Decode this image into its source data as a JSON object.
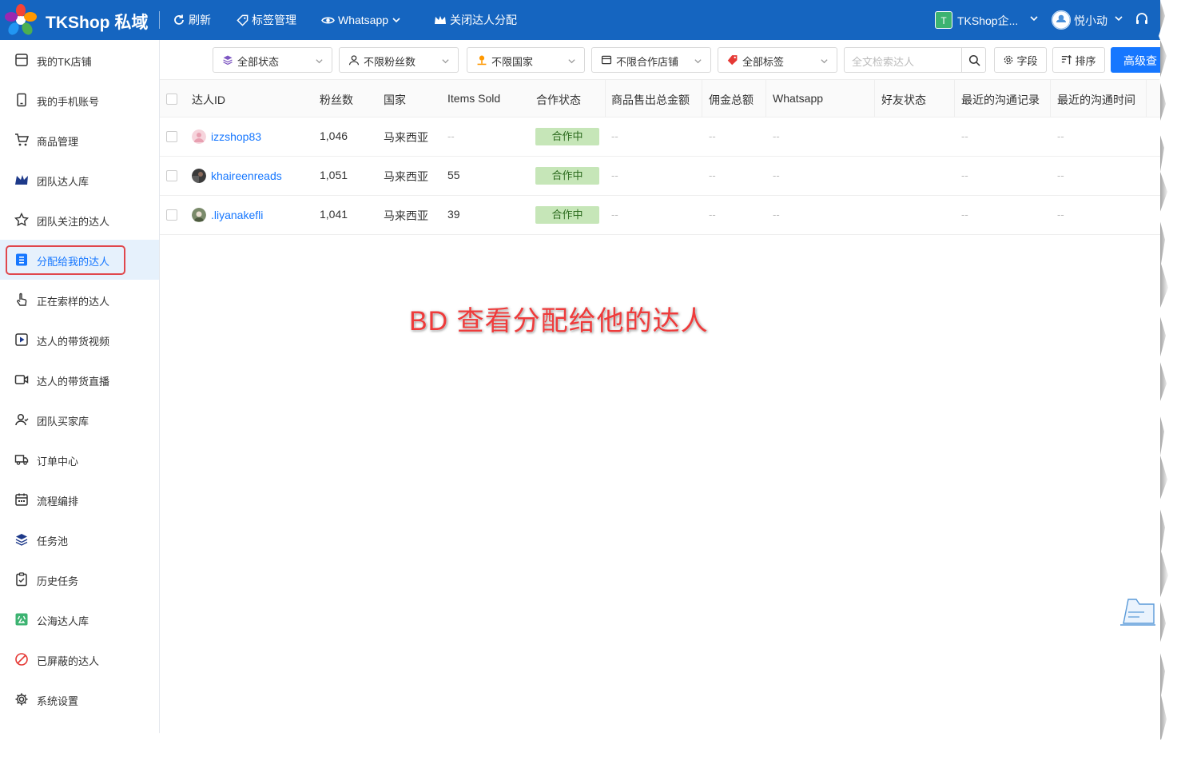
{
  "header": {
    "brand": "TKShop 私域",
    "refresh_label": "刷新",
    "tag_manage_label": "标签管理",
    "whatsapp_label": "Whatsapp",
    "close_assign_label": "关闭达人分配",
    "workspace_badge": "T",
    "workspace_name": "TKShop企...",
    "user_name": "悦小动"
  },
  "sidebar": {
    "items": [
      {
        "label": "我的TK店铺",
        "icon": "shop-icon"
      },
      {
        "label": "我的手机账号",
        "icon": "phone-icon"
      },
      {
        "label": "商品管理",
        "icon": "cart-icon"
      },
      {
        "label": "团队达人库",
        "icon": "team-creators-icon"
      },
      {
        "label": "团队关注的达人",
        "icon": "star-icon"
      },
      {
        "label": "分配给我的达人",
        "icon": "assigned-icon"
      },
      {
        "label": "正在索样的达人",
        "icon": "hand-icon"
      },
      {
        "label": "达人的带货视频",
        "icon": "video-icon"
      },
      {
        "label": "达人的带货直播",
        "icon": "live-icon"
      },
      {
        "label": "团队买家库",
        "icon": "buyers-icon"
      },
      {
        "label": "订单中心",
        "icon": "truck-icon"
      },
      {
        "label": "流程编排",
        "icon": "calendar-icon"
      },
      {
        "label": "任务池",
        "icon": "layers-icon"
      },
      {
        "label": "历史任务",
        "icon": "clipboard-icon"
      },
      {
        "label": "公海达人库",
        "icon": "public-pool-icon"
      },
      {
        "label": "已屏蔽的达人",
        "icon": "block-icon"
      },
      {
        "label": "系统设置",
        "icon": "gear-icon"
      }
    ],
    "active_index": 5
  },
  "filters": {
    "status": "全部状态",
    "fans": "不限粉丝数",
    "country": "不限国家",
    "shop": "不限合作店铺",
    "tags": "全部标签",
    "search_placeholder": "全文检索达人",
    "fields_label": "字段",
    "sort_label": "排序",
    "advanced_label": "高级查"
  },
  "table": {
    "columns": [
      "达人ID",
      "粉丝数",
      "国家",
      "Items Sold",
      "合作状态",
      "商品售出总金额",
      "佣金总额",
      "Whatsapp",
      "好友状态",
      "最近的沟通记录",
      "最近的沟通时间"
    ],
    "rows": [
      {
        "id": "izzshop83",
        "fans": "1,046",
        "country": "马来西亚",
        "items_sold": "--",
        "status": "合作中",
        "sales": "--",
        "commission": "--",
        "whatsapp": "--",
        "friend": "",
        "last_record": "--",
        "last_time": "--"
      },
      {
        "id": "khaireenreads",
        "fans": "1,051",
        "country": "马来西亚",
        "items_sold": "55",
        "status": "合作中",
        "sales": "--",
        "commission": "--",
        "whatsapp": "--",
        "friend": "",
        "last_record": "--",
        "last_time": "--"
      },
      {
        "id": ".liyanakefli",
        "fans": "1,041",
        "country": "马来西亚",
        "items_sold": "39",
        "status": "合作中",
        "sales": "--",
        "commission": "--",
        "whatsapp": "--",
        "friend": "",
        "last_record": "--",
        "last_time": "--"
      }
    ]
  },
  "annotation": "BD 查看分配给他的达人",
  "colors": {
    "header_bg": "#1565c0",
    "accent": "#1677ff",
    "status_tag_bg": "#c6e6b8",
    "annotation": "#ee3b3b",
    "highlight_box": "#e0474c"
  }
}
